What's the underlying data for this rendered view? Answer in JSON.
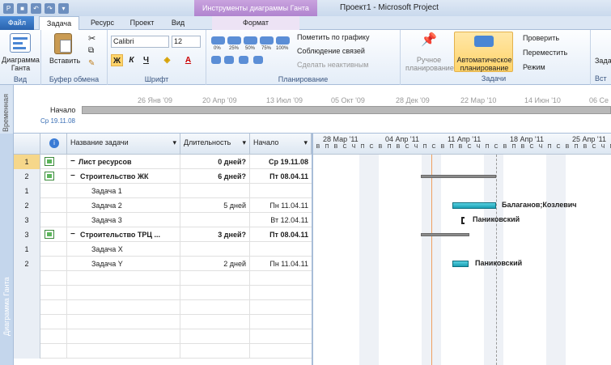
{
  "window": {
    "title": "Проект1  -  Microsoft Project",
    "context_tab_title": "Инструменты диаграммы Ганта"
  },
  "tabs": [
    {
      "label": "Файл"
    },
    {
      "label": "Задача"
    },
    {
      "label": "Ресурс"
    },
    {
      "label": "Проект"
    },
    {
      "label": "Вид"
    },
    {
      "label": "Формат"
    }
  ],
  "ribbon": {
    "view_group": {
      "button": "Диаграмма Ганта",
      "label": "Вид"
    },
    "clipboard_group": {
      "paste": "Вставить",
      "label": "Буфер обмена"
    },
    "font_group": {
      "font_name": "Calibri",
      "font_size": "12",
      "label": "Шрифт",
      "bold": "Ж",
      "italic": "К",
      "underline": "Ч"
    },
    "schedule_group": {
      "pct": [
        "0%",
        "25%",
        "50%",
        "75%",
        "100%"
      ],
      "mark_on_track": "Пометить по графику",
      "respect_links": "Соблюдение связей",
      "inactivate": "Сделать неактивным",
      "label": "Планирование"
    },
    "tasks_group": {
      "manual": "Ручное планирование",
      "auto": "Автоматическое планирование",
      "inspect": "Проверить",
      "move": "Переместить",
      "mode": "Режим",
      "label": "Задачи"
    },
    "insert_group": {
      "task": "Зада",
      "label": "Вст"
    }
  },
  "timeline": {
    "side_label": "Временная",
    "start_label": "Начало",
    "start_date": "Ср 19.11.08",
    "dates": [
      "26 Янв '09",
      "20 Апр '09",
      "13 Июл '09",
      "05 Окт '09",
      "28 Дек '09",
      "22 Мар '10",
      "14 Июн '10",
      "06 Се"
    ]
  },
  "side_label": "Диаграмма Ганта",
  "grid": {
    "headers": {
      "name": "Название задачи",
      "duration": "Длительность",
      "start": "Начало"
    },
    "rows": [
      {
        "num": "1",
        "name": "Лист ресурсов",
        "duration": "0 дней?",
        "start": "Ср 19.11.08",
        "bold": true,
        "level": 0
      },
      {
        "num": "2",
        "name": "Строительство ЖК",
        "duration": "6 дней?",
        "start": "Пт 08.04.11",
        "bold": true,
        "level": 1
      },
      {
        "num": "1",
        "name": "Задача 1",
        "duration": "",
        "start": "",
        "bold": false,
        "level": 2
      },
      {
        "num": "2",
        "name": "Задача 2",
        "duration": "5 дней",
        "start": "Пн 11.04.11",
        "bold": false,
        "level": 2
      },
      {
        "num": "3",
        "name": "Задача 3",
        "duration": "",
        "start": "Вт 12.04.11",
        "bold": false,
        "level": 2
      },
      {
        "num": "3",
        "name": "Строительство ТРЦ ...",
        "duration": "3 дней?",
        "start": "Пт 08.04.11",
        "bold": true,
        "level": 1
      },
      {
        "num": "1",
        "name": "Задача X",
        "duration": "",
        "start": "",
        "bold": false,
        "level": 2
      },
      {
        "num": "2",
        "name": "Задача Y",
        "duration": "2 дней",
        "start": "Пн 11.04.11",
        "bold": false,
        "level": 2
      }
    ]
  },
  "gantt": {
    "weeks": [
      "28 Мар '11",
      "04 Апр '11",
      "11 Апр '11",
      "18 Апр '11",
      "25 Апр '11"
    ],
    "days": [
      "В",
      "П",
      "В",
      "С",
      "Ч",
      "П",
      "С"
    ],
    "resources": {
      "task2": "Балаганов;Козлевич",
      "task3": "Паниковский",
      "taskY": "Паниковский"
    }
  }
}
